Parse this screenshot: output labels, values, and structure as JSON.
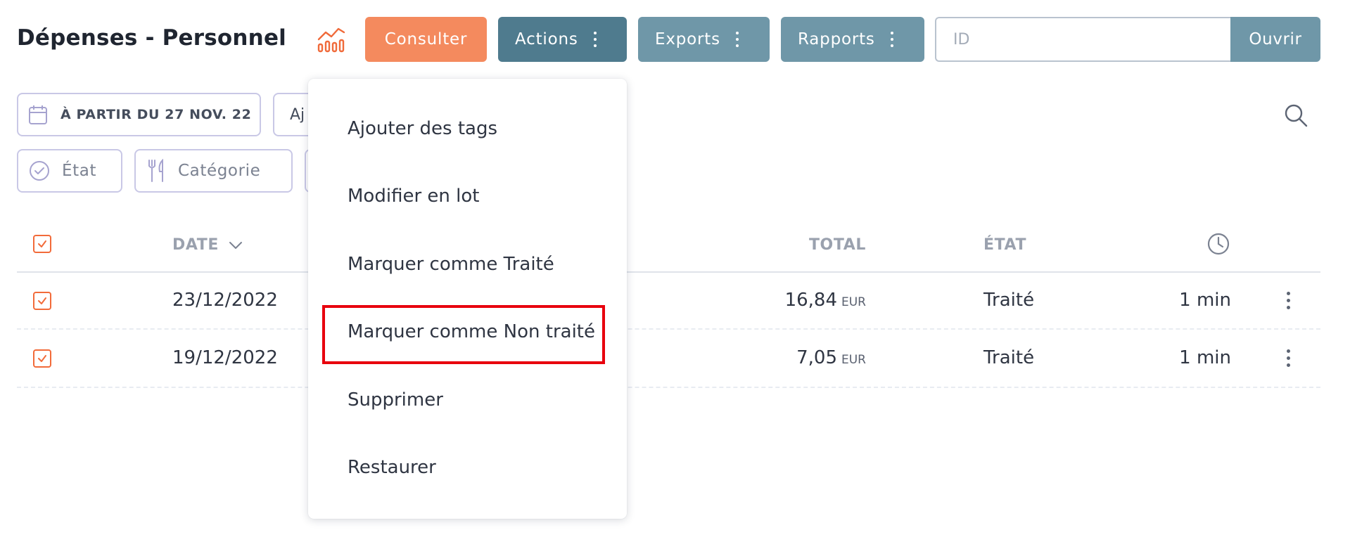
{
  "header": {
    "title": "Dépenses - Personnel",
    "buttons": {
      "consult": "Consulter",
      "actions": "Actions",
      "exports": "Exports",
      "reports": "Rapports",
      "open": "Ouvrir"
    },
    "id_input": {
      "placeholder": "ID",
      "value": ""
    }
  },
  "filters": {
    "date_chip": "À PARTIR DU 27 NOV. 22",
    "add_chip_partial": "Aj",
    "state_chip": "État",
    "category_chip": "Catégorie"
  },
  "table": {
    "columns": {
      "date": "DATE",
      "total": "TOTAL",
      "state": "ÉTAT"
    },
    "rows": [
      {
        "date": "23/12/2022",
        "total": "16,84",
        "currency": "EUR",
        "state": "Traité",
        "time": "1 min",
        "checked": true
      },
      {
        "date": "19/12/2022",
        "total": "7,05",
        "currency": "EUR",
        "state": "Traité",
        "time": "1 min",
        "checked": true
      }
    ]
  },
  "actions_menu": {
    "items": [
      "Ajouter des tags",
      "Modifier en lot",
      "Marquer comme Traité",
      "Marquer comme Non traité",
      "Supprimer",
      "Restaurer"
    ],
    "highlighted_index": 3
  },
  "colors": {
    "primary_orange": "#f48a5e",
    "actions_blue": "#4f7b8e",
    "secondary_blue": "#6f97a8",
    "checkbox_orange": "#f26b3a",
    "highlight_red": "#e8000d"
  },
  "icons": [
    "chart-icon",
    "calendar-icon",
    "check-circle-icon",
    "fork-knife-icon",
    "search-icon",
    "clock-icon",
    "chevron-down-icon",
    "kebab-icon"
  ]
}
